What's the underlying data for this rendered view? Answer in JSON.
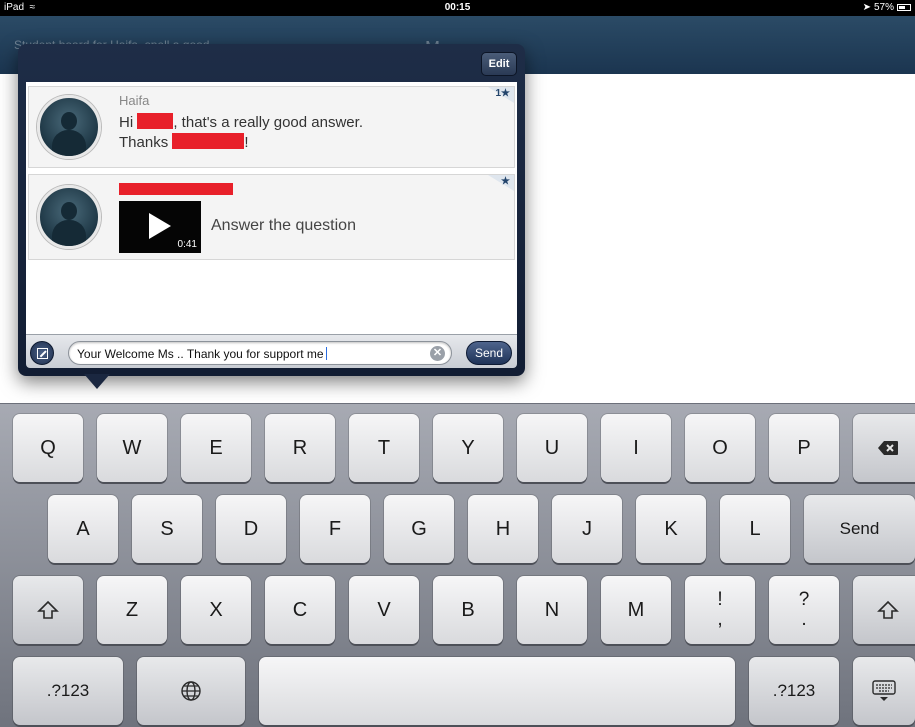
{
  "status_bar": {
    "device": "iPad",
    "time": "00:15",
    "battery": "57%"
  },
  "nav": {
    "left_text": "Student board for Haifa, spell a good",
    "title": "Mess"
  },
  "popover": {
    "edit_label": "Edit",
    "messages": [
      {
        "sender": "Haifa",
        "text_parts": [
          "Hi ",
          ", that's a really good answer.",
          "Thanks ",
          "!"
        ],
        "stars": "1★"
      },
      {
        "stars": "★",
        "video_duration": "0:41",
        "video_label": "Answer the question"
      }
    ],
    "compose": {
      "value": "Your Welcome Ms .. Thank you for support me",
      "clear_symbol": "✕",
      "send_label": "Send"
    }
  },
  "keyboard": {
    "row1": [
      "Q",
      "W",
      "E",
      "R",
      "T",
      "Y",
      "U",
      "I",
      "O",
      "P"
    ],
    "row2": [
      "A",
      "S",
      "D",
      "F",
      "G",
      "H",
      "J",
      "K",
      "L"
    ],
    "row2_action": "Send",
    "row3": [
      "Z",
      "X",
      "C",
      "V",
      "B",
      "N",
      "M"
    ],
    "row3_punct": [
      {
        "top": "!",
        "bottom": ","
      },
      {
        "top": "?",
        "bottom": "."
      }
    ],
    "numbers_label": ".?123"
  }
}
